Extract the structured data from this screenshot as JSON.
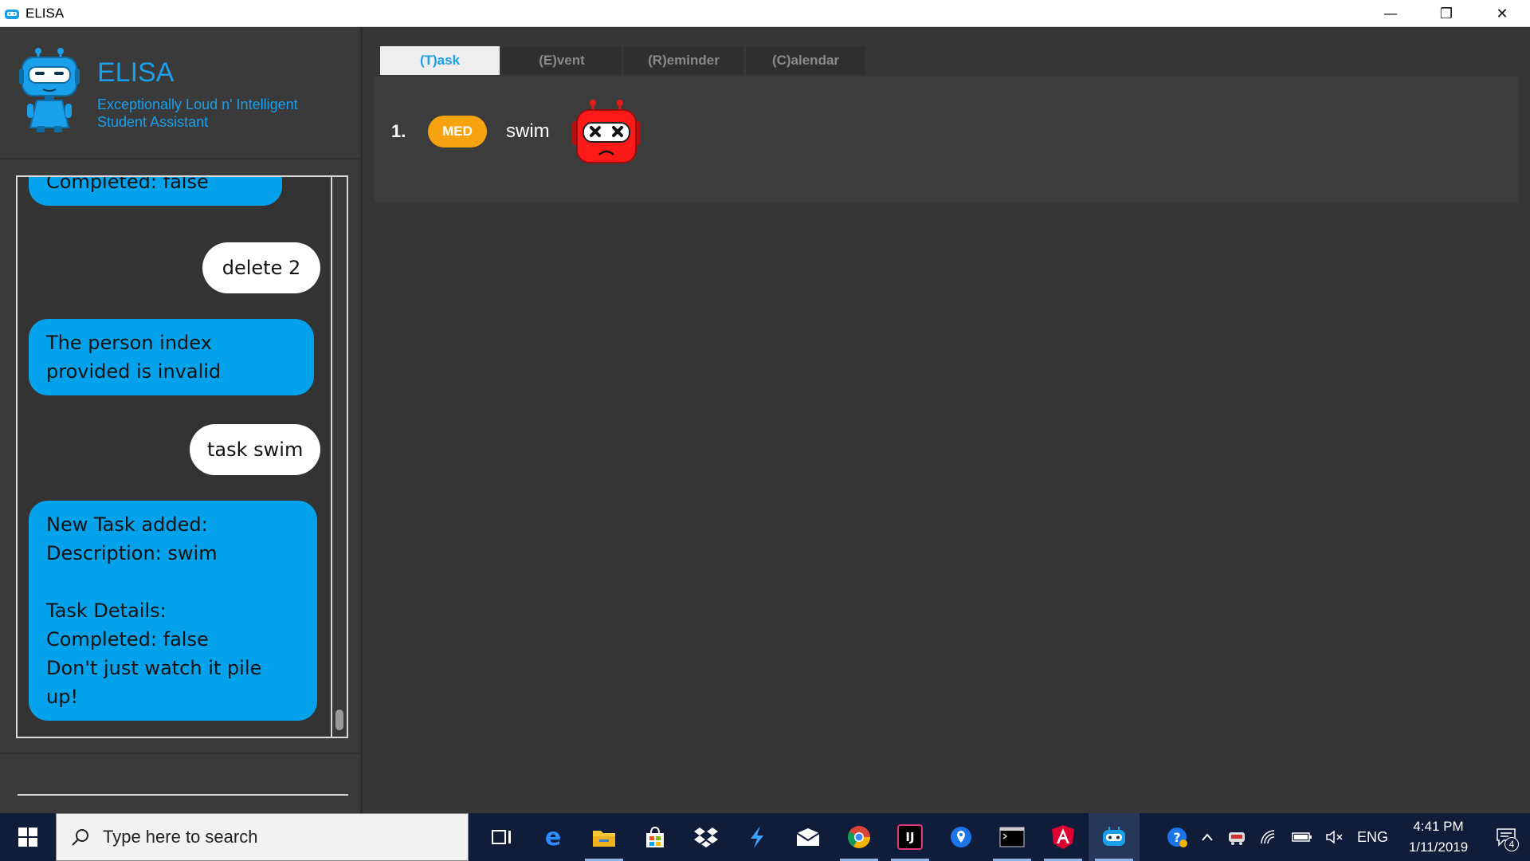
{
  "window": {
    "title": "ELISA",
    "controls": {
      "minimize": "—",
      "restore": "❐",
      "close": "✕"
    }
  },
  "brand": {
    "name": "ELISA",
    "subtitle_line1": "Exceptionally Loud n' Intelligent",
    "subtitle_line2": "Student Assistant",
    "accent_color": "#1a9fea"
  },
  "chat": {
    "messages": [
      {
        "from": "bot",
        "lines": [
          "Completed: false"
        ]
      },
      {
        "from": "user",
        "lines": [
          "delete 2"
        ]
      },
      {
        "from": "bot",
        "lines": [
          "The person index",
          "provided is invalid"
        ]
      },
      {
        "from": "user",
        "lines": [
          "task swim"
        ]
      },
      {
        "from": "bot",
        "lines": [
          "New Task added:",
          "Description: swim",
          "",
          "Task Details:",
          "Completed: false",
          "Don't just watch it pile",
          "up!"
        ]
      }
    ],
    "bot_color": "#03a2eb",
    "user_color": "#ffffff"
  },
  "tabs": [
    {
      "label": "(T)ask",
      "active": true
    },
    {
      "label": "(E)vent",
      "active": false
    },
    {
      "label": "(R)eminder",
      "active": false
    },
    {
      "label": "(C)alendar",
      "active": false
    }
  ],
  "tasks": [
    {
      "index": "1.",
      "priority": "MED",
      "priority_color": "#f7a310",
      "description": "swim",
      "icon": "angry-robot-icon"
    }
  ],
  "taskbar": {
    "search_placeholder": "Type here to search",
    "apps": [
      "task-view-icon",
      "edge-icon",
      "file-explorer-icon",
      "store-icon",
      "dropbox-icon",
      "visual-studio-icon",
      "mail-icon",
      "chrome-icon",
      "intellij-icon",
      "maps-icon",
      "terminal-icon",
      "angular-icon",
      "elisa-icon"
    ],
    "language": "ENG",
    "time": "4:41 PM",
    "date": "1/11/2019",
    "notification_count": "4"
  }
}
